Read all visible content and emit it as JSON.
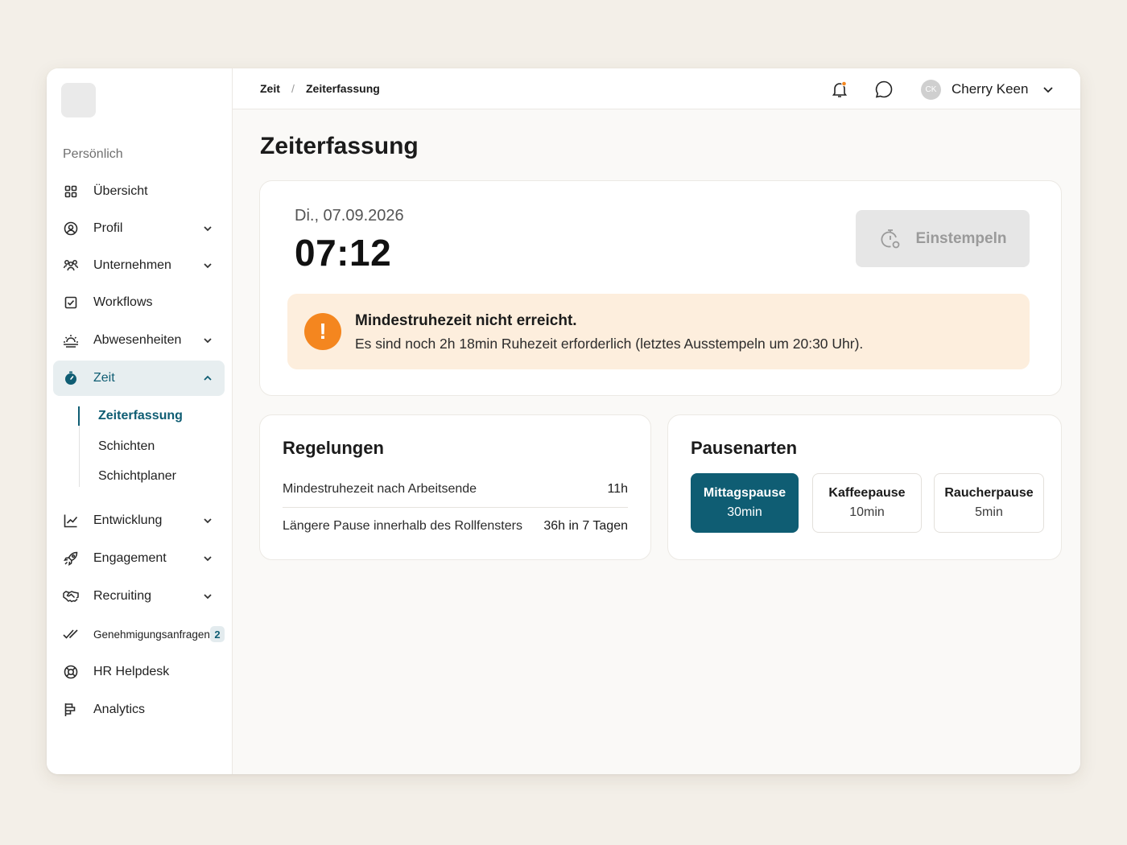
{
  "sidebar": {
    "section_title": "Persönlich",
    "items": [
      {
        "label": "Übersicht",
        "icon": "grid-icon"
      },
      {
        "label": "Profil",
        "icon": "user-circle-icon"
      },
      {
        "label": "Unternehmen",
        "icon": "team-icon"
      },
      {
        "label": "Workflows",
        "icon": "checkbox-icon"
      },
      {
        "label": "Abwesenheiten",
        "icon": "sunrise-icon"
      },
      {
        "label": "Zeit",
        "icon": "stopwatch-icon"
      },
      {
        "label": "Entwicklung",
        "icon": "chart-line-icon"
      },
      {
        "label": "Engagement",
        "icon": "rocket-icon"
      },
      {
        "label": "Recruiting",
        "icon": "handshake-icon"
      },
      {
        "label": "Genehmigungsanfragen",
        "icon": "double-check-icon",
        "badge": "2"
      },
      {
        "label": "HR Helpdesk",
        "icon": "lifebuoy-icon"
      },
      {
        "label": "Analytics",
        "icon": "flag-icon"
      }
    ],
    "sub_items": [
      "Zeiterfassung",
      "Schichten",
      "Schichtplaner"
    ]
  },
  "topbar": {
    "breadcrumb": [
      "Zeit",
      "Zeiterfassung"
    ],
    "breadcrumb_separator": "/",
    "user_initials": "CK",
    "user_name": "Cherry Keen"
  },
  "page": {
    "title": "Zeiterfassung"
  },
  "clock_card": {
    "date": "Di., 07.09.2026",
    "time": "07:12",
    "stamp_button": "Einstempeln",
    "alert_title": "Mindestruhezeit nicht erreicht.",
    "alert_text": "Es sind noch 2h 18min Ruhezeit erforderlich (letztes Ausstempeln um 20:30 Uhr).",
    "alert_icon": "!"
  },
  "rules": {
    "title": "Regelungen",
    "rows": [
      {
        "label": "Mindestruhezeit nach Arbeitsende",
        "value": "11h"
      },
      {
        "label": "Längere Pause innerhalb des Rollfensters",
        "value": "36h in 7 Tagen"
      }
    ]
  },
  "breaks": {
    "title": "Pausenarten",
    "options": [
      {
        "name": "Mittagspause",
        "duration": "30min",
        "selected": true
      },
      {
        "name": "Kaffeepause",
        "duration": "10min",
        "selected": false
      },
      {
        "name": "Raucherpause",
        "duration": "5min",
        "selected": false
      }
    ]
  },
  "colors": {
    "accent": "#0f5d73",
    "warning": "#f4861f",
    "warning_bg": "#fdeedd",
    "background": "#f3efe8"
  }
}
